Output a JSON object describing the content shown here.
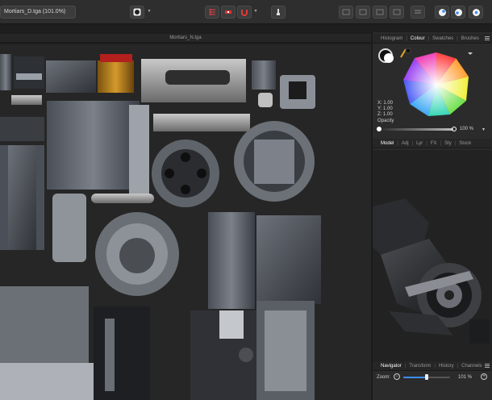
{
  "toolbar": {
    "file_label": "Mortiars_D.tga (101.0%)",
    "icons": [
      "circle-selector-icon",
      "grid-icon",
      "flag-icon",
      "magnet-icon",
      "brush-icon",
      "arrange-icon",
      "panel-icon",
      "palette-icon"
    ]
  },
  "document": {
    "title": "Mortiars_N.tga"
  },
  "panel": {
    "top_tabs": [
      "Histogram",
      "Colour",
      "Swatches",
      "Brushes"
    ],
    "active_top_tab": "Colour",
    "colour": {
      "x": "X: 1.00",
      "y": "Y: 1.00",
      "z": "Z: 1.00",
      "opacity_label": "Opacity",
      "opacity_value": "100 %",
      "opacity_fraction": 1.0
    },
    "mid_tabs": [
      "Model",
      "Adj",
      "Lyr",
      "FX",
      "Sty",
      "Stock"
    ],
    "active_mid_tab": "Model",
    "bottom_tabs": [
      "Navigator",
      "Transform",
      "History",
      "Channels"
    ],
    "active_bottom_tab": "Navigator",
    "zoom": {
      "label": "Zoom:",
      "value": "101 %",
      "fraction": 0.5
    }
  },
  "colors": {
    "accent": "#3d8ef0",
    "panel_bg": "#2b2b2b",
    "canvas_bg": "#262626"
  }
}
